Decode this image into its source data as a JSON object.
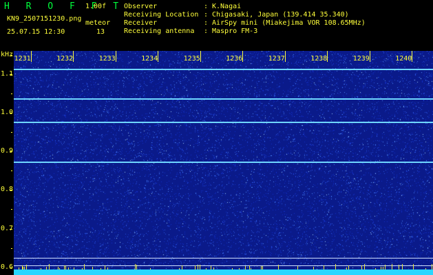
{
  "header": {
    "app_title": "H R O F F T",
    "version": "1.00f",
    "filename": "KN9_2507151230.png",
    "mode": "meteor",
    "datetime": "25.07.15 12:30",
    "count": "13",
    "fields": [
      {
        "label": "Observer",
        "value": "K.Nagai"
      },
      {
        "label": "Receiving Location",
        "value": "Chigasaki, Japan (139.414 35.340)"
      },
      {
        "label": "Receiver",
        "value": "AirSpy mini (Miakejima VOR 108.65MHz)"
      },
      {
        "label": "Receiving antenna",
        "value": "Maspro FM-3"
      }
    ]
  },
  "spectrogram": {
    "y_unit": "kHz",
    "y_ticks": [
      "1.1",
      "1.0",
      "0.9",
      "0.8",
      "0.7",
      "0.6"
    ],
    "y_range": [
      0.58,
      1.16
    ],
    "x_ticks": [
      "1231",
      "1232",
      "1233",
      "1234",
      "1235",
      "1236",
      "1237",
      "1238",
      "1239",
      "1240"
    ],
    "x_range": [
      1230.6,
      1240.5
    ],
    "signal_lines_khz": [
      1.112,
      1.035,
      0.975,
      0.872
    ],
    "marker_lines_khz": [
      0.625,
      0.605
    ],
    "colors": {
      "background": "#0a1a8a",
      "signal": "#6fd6ff",
      "floor": "#29d6ff",
      "text": "#ffff3a",
      "title": "#00ff3c"
    }
  }
}
